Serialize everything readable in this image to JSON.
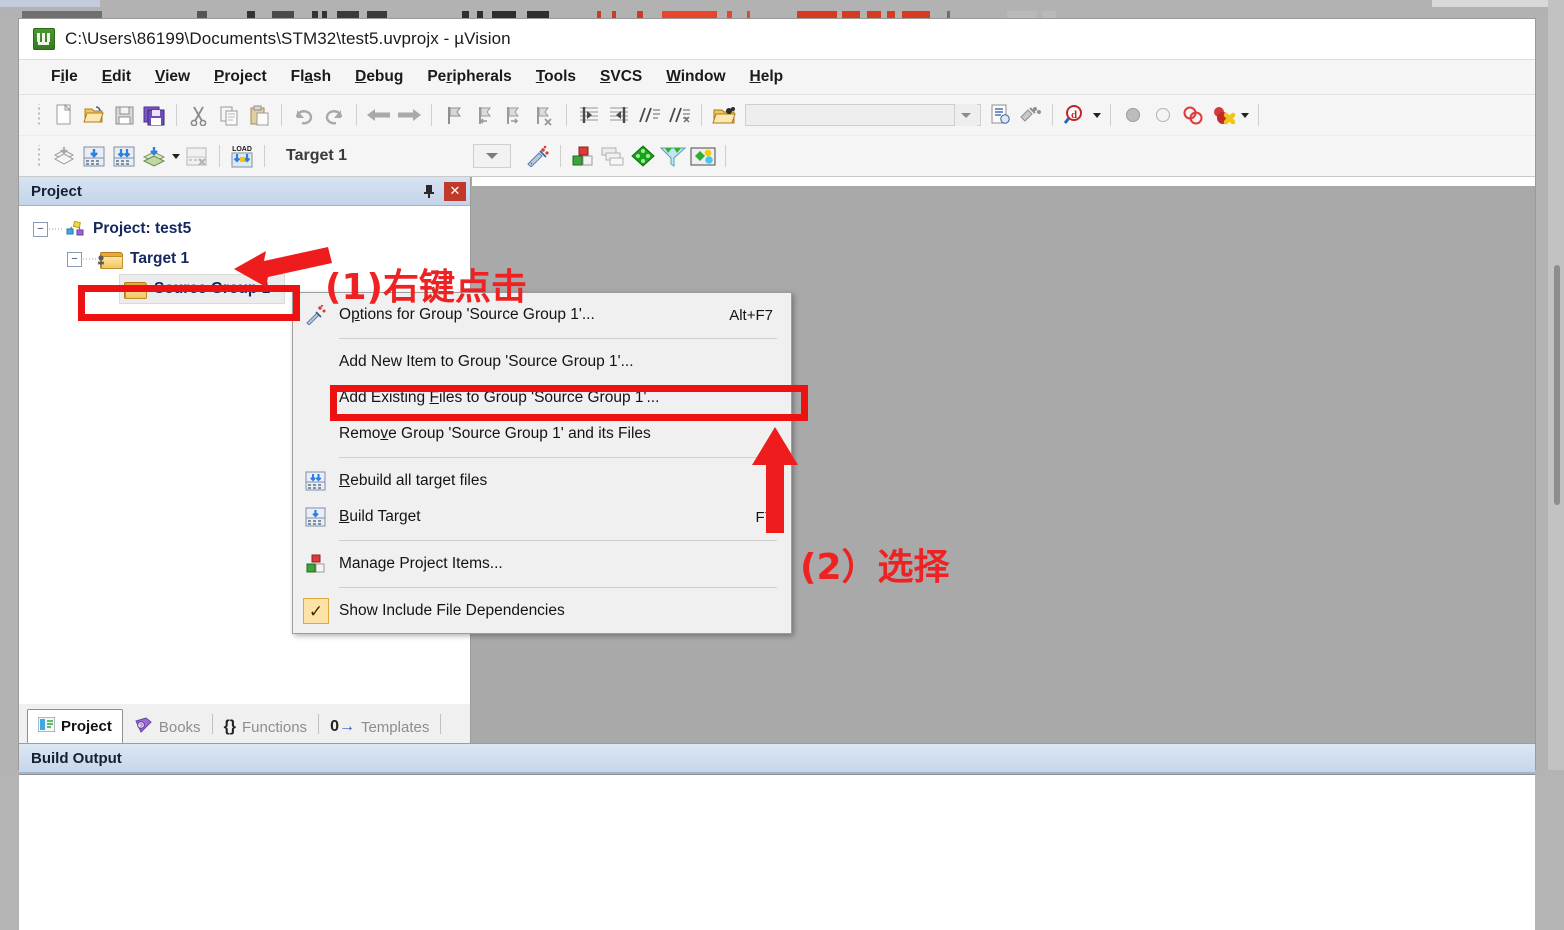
{
  "window": {
    "title": "C:\\Users\\86199\\Documents\\STM32\\test5.uvprojx - µVision",
    "app_icon": "uvision-logo-icon"
  },
  "menubar": [
    {
      "label": "File",
      "pre": "F",
      "hot": "i",
      "post": "le"
    },
    {
      "label": "Edit",
      "pre": "",
      "hot": "E",
      "post": "dit"
    },
    {
      "label": "View",
      "pre": "",
      "hot": "V",
      "post": "iew"
    },
    {
      "label": "Project",
      "pre": "",
      "hot": "P",
      "post": "roject"
    },
    {
      "label": "Flash",
      "pre": "Fl",
      "hot": "a",
      "post": "sh"
    },
    {
      "label": "Debug",
      "pre": "",
      "hot": "D",
      "post": "ebug"
    },
    {
      "label": "Peripherals",
      "pre": "Pe",
      "hot": "r",
      "post": "ipherals"
    },
    {
      "label": "Tools",
      "pre": "",
      "hot": "T",
      "post": "ools"
    },
    {
      "label": "SVCS",
      "pre": "",
      "hot": "S",
      "post": "VCS"
    },
    {
      "label": "Window",
      "pre": "",
      "hot": "W",
      "post": "indow"
    },
    {
      "label": "Help",
      "pre": "",
      "hot": "H",
      "post": "elp"
    }
  ],
  "toolbar1": {
    "buttons": [
      "new-file-icon",
      "open-file-icon",
      "save-icon",
      "save-all-icon",
      "cut-icon",
      "copy-icon",
      "paste-icon",
      "undo-icon",
      "redo-icon",
      "navigate-back-icon",
      "navigate-forward-icon",
      "bookmark-toggle-icon",
      "bookmark-prev-icon",
      "bookmark-next-icon",
      "bookmark-clear-icon",
      "indent-icon",
      "outdent-icon",
      "comment-icon",
      "uncomment-icon",
      "open-folder-icon"
    ],
    "search_value": "",
    "search_placeholder": "",
    "right_buttons": [
      "insert-file-icon",
      "find-in-files-icon",
      "find-icon",
      "breakpoint-icon",
      "disable-breakpoint-icon",
      "disable-all-breakpoints-icon",
      "kill-all-breakpoints-icon"
    ]
  },
  "toolbar2": {
    "buttons": [
      "translate-icon",
      "build-icon",
      "rebuild-icon",
      "batch-build-icon",
      "stop-build-icon",
      "download-icon"
    ],
    "target_value": "Target 1",
    "right_buttons": [
      "target-options-icon",
      "manage-project-items-icon",
      "multi-project-icon",
      "configuration-wizard-icon",
      "pack-installer-icon",
      "run-manage-runtime-icon"
    ]
  },
  "project_pane": {
    "title": "Project",
    "pin_icon": "pin-icon",
    "close_icon": "close-icon",
    "tree": [
      {
        "label": "Project: test5",
        "icon": "project-icon",
        "expander": "−",
        "depth": 0
      },
      {
        "label": "Target 1",
        "icon": "target-folder-icon",
        "expander": "−",
        "depth": 1
      },
      {
        "label": "Source Group 1",
        "icon": "folder-icon",
        "expander": "",
        "depth": 2
      }
    ],
    "tabs": [
      {
        "label": "Project",
        "icon": "project-tab-icon",
        "active": true
      },
      {
        "label": "Books",
        "icon": "books-tab-icon",
        "active": false
      },
      {
        "label": "Functions",
        "icon": "functions-tab-icon",
        "active": false
      },
      {
        "label": "Templates",
        "icon": "templates-tab-icon",
        "active": false
      }
    ]
  },
  "build_output": {
    "title": "Build Output",
    "content": ""
  },
  "context_menu": {
    "items": [
      {
        "type": "item",
        "icon": "options-wand-icon",
        "label_pre": "O",
        "label_hot": "p",
        "label_post": "tions for Group 'Source Group 1'...",
        "shortcut": "Alt+F7",
        "checked": false
      },
      {
        "type": "separator"
      },
      {
        "type": "item",
        "icon": "",
        "label_pre": "Add New  Item to Group 'Source Group 1'...",
        "label_hot": "",
        "label_post": "",
        "shortcut": "",
        "checked": false
      },
      {
        "type": "item",
        "icon": "",
        "label_pre": "Add Existing ",
        "label_hot": "F",
        "label_post": "iles to Group 'Source Group 1'...",
        "shortcut": "",
        "checked": false,
        "highlight": true
      },
      {
        "type": "item",
        "icon": "",
        "label_pre": "Remo",
        "label_hot": "v",
        "label_post": "e Group 'Source Group 1' and its Files",
        "shortcut": "",
        "checked": false
      },
      {
        "type": "separator"
      },
      {
        "type": "item",
        "icon": "rebuild-icon",
        "label_pre": "",
        "label_hot": "R",
        "label_post": "ebuild all target files",
        "shortcut": "",
        "checked": false
      },
      {
        "type": "item",
        "icon": "build-icon",
        "label_pre": "",
        "label_hot": "B",
        "label_post": "uild Target",
        "shortcut": "F7",
        "checked": false
      },
      {
        "type": "separator"
      },
      {
        "type": "item",
        "icon": "manage-project-items-icon",
        "label_pre": "Manage Project Items...",
        "label_hot": "",
        "label_post": "",
        "shortcut": "",
        "checked": false
      },
      {
        "type": "separator"
      },
      {
        "type": "item",
        "icon": "checkmark-icon",
        "label_pre": "Show Include File Dependencies",
        "label_hot": "",
        "label_post": "",
        "shortcut": "",
        "checked": true
      }
    ]
  },
  "annotations": {
    "step1_text": "(1)右键点击",
    "step2_text": "(2）选择",
    "color": "#ee2222",
    "box_source_group": "highlight-box-source-group",
    "box_add_existing": "highlight-box-add-existing-files",
    "arrow_to_tree": "arrow-pointing-left-to-source-group",
    "arrow_to_menu": "arrow-pointing-up-to-add-existing-files"
  }
}
